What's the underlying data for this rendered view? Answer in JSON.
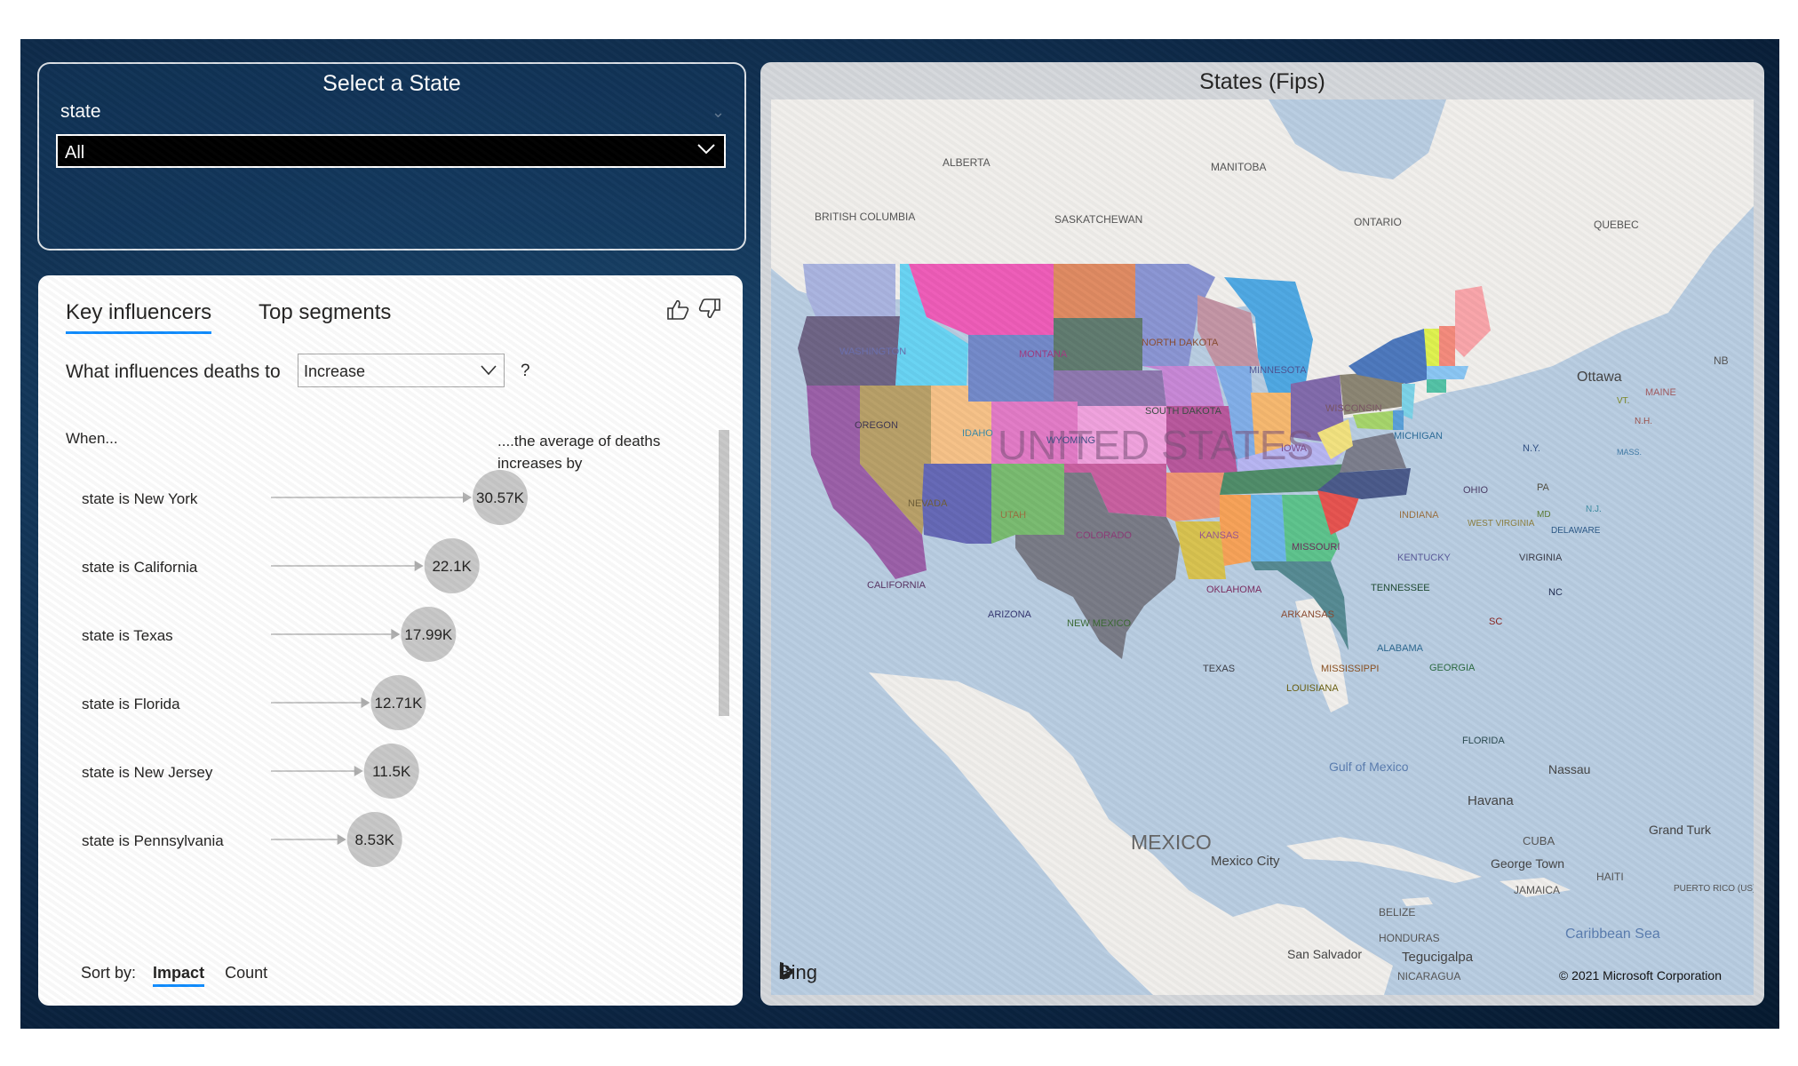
{
  "slicer": {
    "title": "Select a State",
    "field": "state",
    "value": "All"
  },
  "key_influencers": {
    "tabs": [
      "Key influencers",
      "Top segments"
    ],
    "question": "What influences deaths to",
    "direction": "Increase",
    "question_mark": "?",
    "when_label": "When...",
    "avg_label": "....the average of deaths increases by",
    "rows": [
      {
        "label": "state is New York",
        "value": "30.57K",
        "impact": 30570
      },
      {
        "label": "state is California",
        "value": "22.1K",
        "impact": 22100
      },
      {
        "label": "state is Texas",
        "value": "17.99K",
        "impact": 17990
      },
      {
        "label": "state is Florida",
        "value": "12.71K",
        "impact": 12710
      },
      {
        "label": "state is New Jersey",
        "value": "11.5K",
        "impact": 11500
      },
      {
        "label": "state is Pennsylvania",
        "value": "8.53K",
        "impact": 8530
      }
    ],
    "sort_by_label": "Sort by:",
    "sort_options": [
      "Impact",
      "Count"
    ],
    "sort_selected": "Impact",
    "accent": "#118DFF"
  },
  "map": {
    "title": "States (Fips)",
    "provider": "Bing",
    "copyright": "© 2021 Microsoft Corporation",
    "country_label": "UNITED STATES",
    "region_labels": [
      "ALBERTA",
      "MANITOBA",
      "BRITISH COLUMBIA",
      "SASKATCHEWAN",
      "ONTARIO",
      "QUEBEC",
      "NB",
      "MEXICO",
      "Gulf of Mexico",
      "Caribbean Sea"
    ],
    "city_labels": [
      "Ottawa",
      "Nassau",
      "Havana",
      "Grand Turk",
      "CUBA",
      "George Town",
      "HAITI",
      "JAMAICA",
      "PUERTO RICO (US)",
      "Mexico City",
      "BELIZE",
      "HONDURAS",
      "Tegucigalpa",
      "San Salvador",
      "NICARAGUA"
    ],
    "state_labels": [
      "WASHINGTON",
      "MONTANA",
      "NORTH DAKOTA",
      "MINNESOTA",
      "OREGON",
      "IDAHO",
      "WYOMING",
      "SOUTH DAKOTA",
      "WISCONSIN",
      "MICHIGAN",
      "N.Y.",
      "VT.",
      "N.H.",
      "MAINE",
      "MASS.",
      "IOWA",
      "PA",
      "OHIO",
      "NEVADA",
      "UTAH",
      "COLORADO",
      "KANSAS",
      "MISSOURI",
      "INDIANA",
      "WEST VIRGINIA",
      "N.J.",
      "MD",
      "DELAWARE",
      "CALIFORNIA",
      "KENTUCKY",
      "VIRGINIA",
      "OKLAHOMA",
      "TENNESSEE",
      "NC",
      "ARIZONA",
      "NEW MEXICO",
      "ARKANSAS",
      "SC",
      "TEXAS",
      "MISSISSIPPI",
      "ALABAMA",
      "GEORGIA",
      "LOUISIANA",
      "FLORIDA"
    ]
  }
}
